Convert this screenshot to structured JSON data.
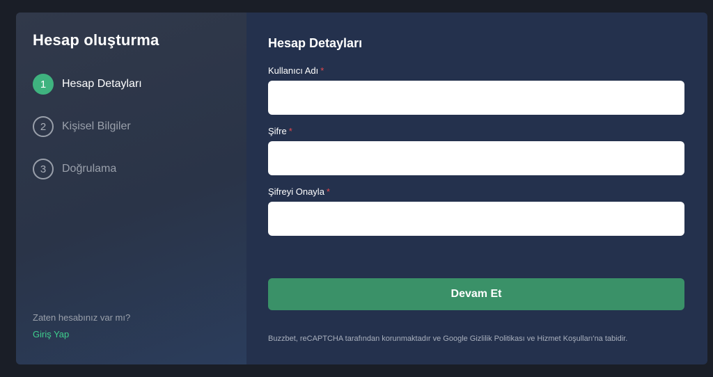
{
  "sidebar": {
    "title": "Hesap oluşturma",
    "steps": [
      {
        "number": "1",
        "label": "Hesap Detayları",
        "active": true
      },
      {
        "number": "2",
        "label": "Kişisel Bilgiler",
        "active": false
      },
      {
        "number": "3",
        "label": "Doğrulama",
        "active": false
      }
    ],
    "login_prompt": "Zaten hesabınız var mı?",
    "login_link": "Giriş Yap"
  },
  "form": {
    "title": "Hesap Detayları",
    "fields": [
      {
        "label": "Kullanıcı Adı",
        "required_mark": "*",
        "value": "",
        "placeholder": ""
      },
      {
        "label": "Şifre",
        "required_mark": "*",
        "value": "",
        "placeholder": ""
      },
      {
        "label": "Şifreyi Onayla",
        "required_mark": "*",
        "value": "",
        "placeholder": ""
      }
    ],
    "submit_label": "Devam Et",
    "footer_note": "Buzzbet, reCAPTCHA tarafından korunmaktadır ve Google Gizlilik Politikası ve Hizmet Koşulları'na tabidir."
  },
  "colors": {
    "accent_green": "#3fb37f",
    "button_green": "#3a9168",
    "link_green": "#3fcf8e",
    "required_red": "#e5484d",
    "panel_bg": "#24314d"
  }
}
